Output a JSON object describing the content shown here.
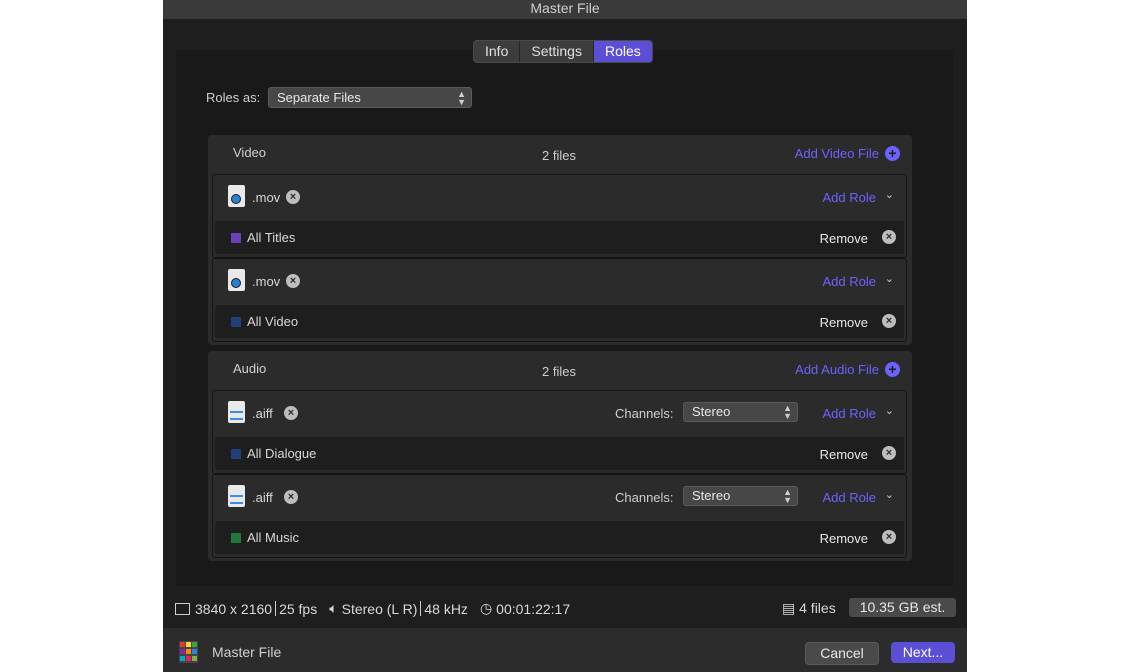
{
  "window": {
    "title": "Master File"
  },
  "tabs": [
    {
      "label": "Info",
      "active": false
    },
    {
      "label": "Settings",
      "active": false
    },
    {
      "label": "Roles",
      "active": true
    }
  ],
  "roles_as": {
    "label": "Roles as:",
    "value": "Separate Files"
  },
  "video": {
    "title": "Video",
    "count": "2 files",
    "add_label": "Add Video File",
    "files": [
      {
        "ext": ".mov",
        "add_role": "Add Role",
        "role": "All Titles",
        "role_color": "#6a3fb8",
        "remove": "Remove"
      },
      {
        "ext": ".mov",
        "add_role": "Add Role",
        "role": "All Video",
        "role_color": "#1f3f78",
        "remove": "Remove"
      }
    ]
  },
  "audio": {
    "title": "Audio",
    "count": "2 files",
    "add_label": "Add Audio File",
    "files": [
      {
        "ext": ".aiff",
        "channels_label": "Channels:",
        "channels": "Stereo",
        "add_role": "Add Role",
        "role": "All Dialogue",
        "role_color": "#1f3f78",
        "remove": "Remove"
      },
      {
        "ext": ".aiff",
        "channels_label": "Channels:",
        "channels": "Stereo",
        "add_role": "Add Role",
        "role": "All Music",
        "role_color": "#1f7a3a",
        "remove": "Remove"
      }
    ]
  },
  "stats": {
    "resolution": "3840 x 2160",
    "fps": "25 fps",
    "audio": "Stereo (L R)",
    "rate": "48 kHz",
    "duration": "00:01:22:17",
    "files": "4 files",
    "size": "10.35 GB est."
  },
  "footer": {
    "title": "Master File",
    "cancel": "Cancel",
    "next": "Next..."
  },
  "colors": {
    "accent": "#5b4fd6",
    "link": "#6c63ff"
  }
}
